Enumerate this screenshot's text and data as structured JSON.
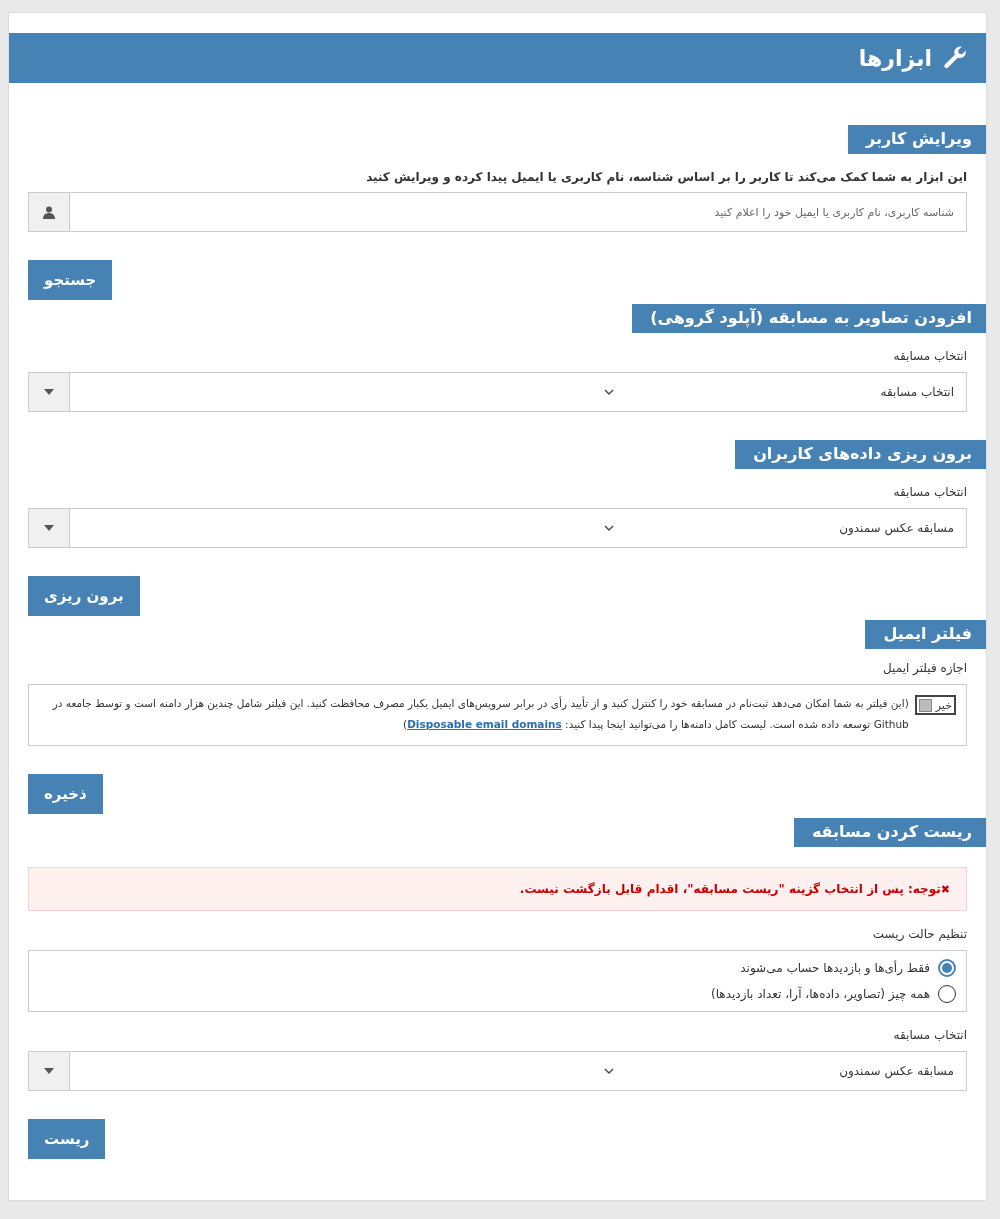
{
  "header": {
    "title": "ابزارها"
  },
  "sections": [
    {
      "kind": "search",
      "title": "ویرایش کاربر",
      "description": "این ابزار به شما کمک می‌کند تا کاربر را بر اساس شناسه، نام کاربری یا ایمیل پیدا کرده و ویرایش کنید",
      "field": {
        "placeholder": "شناسه کاربری، نام کاربری یا ایمیل خود را اعلام کنید"
      },
      "button": "جستجو"
    },
    {
      "kind": "select",
      "title": "افزودن تصاویر به مسابقه (آپلود گروهی)",
      "label": "انتخاب مسابقه",
      "select": {
        "value": "انتخاب مسابقه"
      }
    },
    {
      "kind": "select",
      "title": "برون ریزی داده‌های کاربران",
      "label": "انتخاب مسابقه",
      "select": {
        "value": "مسابقه عکس سمندون"
      },
      "button": "برون ریزی"
    },
    {
      "kind": "toggle",
      "title": "فیلتر ایمیل",
      "label": "اجازه فیلتر ایمیل",
      "toggle": {
        "label": "خیر",
        "on": false
      },
      "note": "(این فیلتر به شما امکان می‌دهد ثبت‌نام در مسابقه خود را کنترل کنید و از تأیید رأی در برابر سرویس‌های ایمیل یکبار مصرف محافظت کنید. این فیلتر شامل چندین هزار دامنه است و توسط جامعه در Github توسعه داده شده است. لیست کامل دامنه‌ها را می‌توانید اینجا پیدا کنید: ",
      "link": "Disposable email domains",
      "note_end": ")",
      "button": "ذخیره"
    },
    {
      "kind": "reset",
      "title": "ریست کردن مسابقه",
      "alert": {
        "icon": "✖",
        "text": "**توجه:** پس از انتخاب گزینه \"ریست مسابقه\"، اقدام قابل بازگشت نیست."
      },
      "radio_label": "تنظیم حالت ریست",
      "options": [
        {
          "label": "فقط رأی‌ها و بازدیدها حساب می‌شوند",
          "selected": true
        },
        {
          "label": "همه چیز (تصاویر، داده‌ها، آرا، تعداد بازدیدها)",
          "selected": false
        }
      ],
      "label": "انتخاب مسابقه",
      "select": {
        "value": "مسابقه عکس سمندون"
      },
      "button": "ریست"
    }
  ]
}
